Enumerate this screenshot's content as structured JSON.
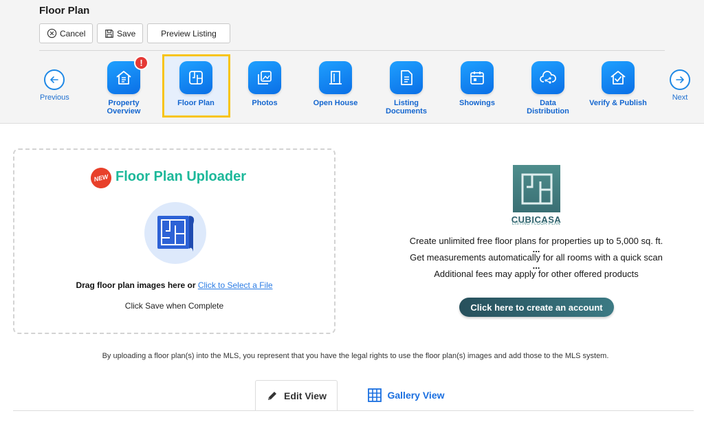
{
  "page": {
    "title": "Floor Plan"
  },
  "toolbar": {
    "cancel_label": "Cancel",
    "save_label": "Save",
    "preview_label": "Preview Listing"
  },
  "steps_nav": {
    "previous_label": "Previous",
    "next_label": "Next",
    "active_step": "Floor Plan",
    "items": [
      {
        "label": "Property Overview",
        "icon": "house-list-icon",
        "alert": "!"
      },
      {
        "label": "Floor Plan",
        "icon": "floor-plan-icon"
      },
      {
        "label": "Photos",
        "icon": "photos-icon"
      },
      {
        "label": "Open House",
        "icon": "door-icon"
      },
      {
        "label": "Listing Documents",
        "icon": "document-icon"
      },
      {
        "label": "Showings",
        "icon": "calendar-icon"
      },
      {
        "label": "Data Distribution",
        "icon": "cloud-share-icon"
      },
      {
        "label": "Verify & Publish",
        "icon": "house-check-icon"
      }
    ]
  },
  "uploader": {
    "badge": "NEW",
    "title": "Floor Plan Uploader",
    "drag_text": "Drag floor plan images here or ",
    "select_link": "Click to Select a File",
    "save_hint": "Click Save when Complete"
  },
  "cubicasa": {
    "name": "CUBICASA",
    "tagline": "LISTING FLOOR PLAN",
    "line1": "Create unlimited free floor plans for properties up to 5,000 sq. ft.",
    "dots": "...",
    "line2": "Get measurements automatically for all rooms with a quick scan",
    "line3": "Additional fees may apply for other offered products",
    "button_label": "Click here to create an account"
  },
  "legal_notice": "By uploading a floor plan(s) into the MLS, you represent that you have the legal rights to use the floor plan(s) images and add those to the MLS system.",
  "view_tabs": {
    "edit_label": "Edit View",
    "gallery_label": "Gallery View"
  },
  "colors": {
    "brand_blue": "#0a6fe6",
    "active_highlight": "#f7c414",
    "uploader_green": "#1db89a",
    "alert_red": "#e53935",
    "cubicasa_teal": "#3c7a84"
  }
}
